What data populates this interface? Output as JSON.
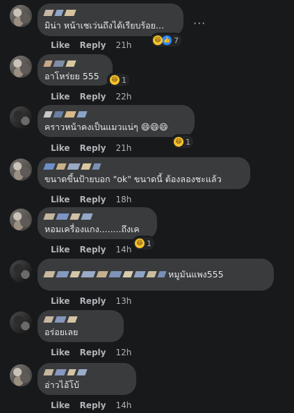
{
  "actions": {
    "like": "Like",
    "reply": "Reply"
  },
  "comments": [
    {
      "text": "มิน่า หน้าเชเว่นถึงได้เรียบร้อย...",
      "time": "21h",
      "reaction_count": "7"
    },
    {
      "text": "อาโหร่ยย 555",
      "time": "22h",
      "reaction_count": "1"
    },
    {
      "text": "คราวหน้าคงเป็นแมวแน่ๆ 😄😄😄",
      "time": "21h",
      "reaction_count": "1"
    },
    {
      "text": "ขนาดขึ้นป้ายบอก \"ok\" ขนาดนี้ ต้องลองชะแล้ว",
      "time": "18h",
      "reaction_count": ""
    },
    {
      "text": "หอมเครื่องแกง........ถึงเค",
      "time": "14h",
      "reaction_count": "1"
    },
    {
      "text": "หมูมันแพง555",
      "time": "13h",
      "reaction_count": ""
    },
    {
      "text": "อร่อยเลย",
      "time": "12h",
      "reaction_count": ""
    },
    {
      "text": "อ่าวไอ้โบ้",
      "time": "14h",
      "reaction_count": ""
    }
  ],
  "colors": {
    "background": "#18191a",
    "bubble": "#3a3b3c",
    "text": "#e4e6eb",
    "meta": "#b0b3b8"
  },
  "icons": {
    "more": "more-options-icon",
    "haha": "haha-emoji-icon",
    "like": "like-reaction-icon"
  }
}
